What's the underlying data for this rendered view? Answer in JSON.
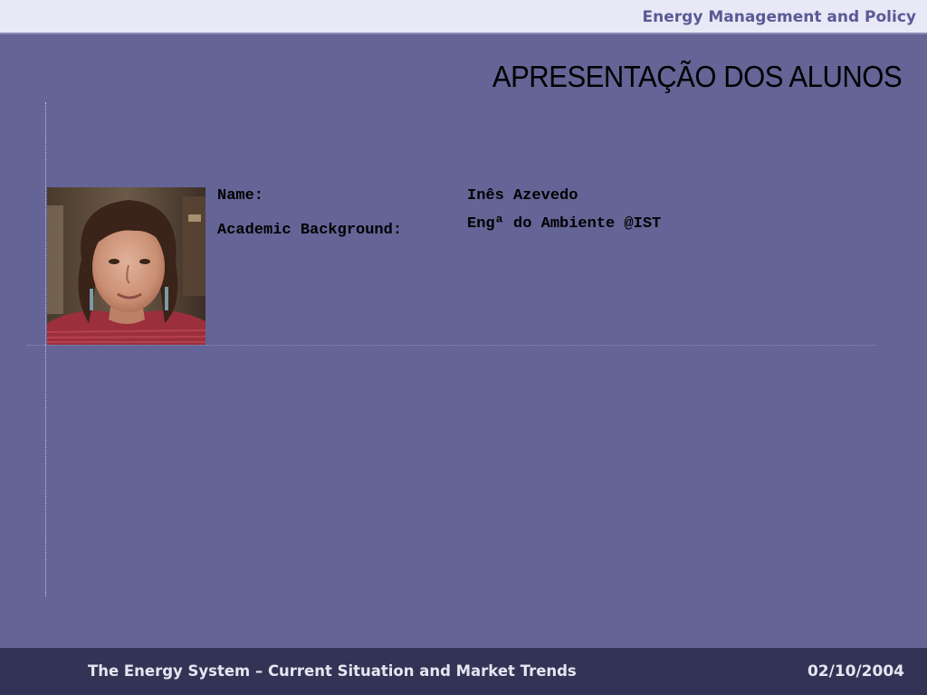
{
  "header": {
    "title": "Energy Management and Policy"
  },
  "slide": {
    "title": "APRESENTAÇÃO DOS ALUNOS"
  },
  "student": {
    "name_label": "Name:",
    "name_value": "Inês Azevedo",
    "background_label": "Academic Background:",
    "background_value": "Engª do Ambiente @IST"
  },
  "footer": {
    "title": "The Energy System – Current Situation and Market Trends",
    "date": "02/10/2004"
  },
  "colors": {
    "slide_background": "#646496",
    "header_background": "#e8e8f6",
    "header_text": "#5a5a96",
    "footer_background": "#333355",
    "footer_text": "#e6e6f2"
  }
}
